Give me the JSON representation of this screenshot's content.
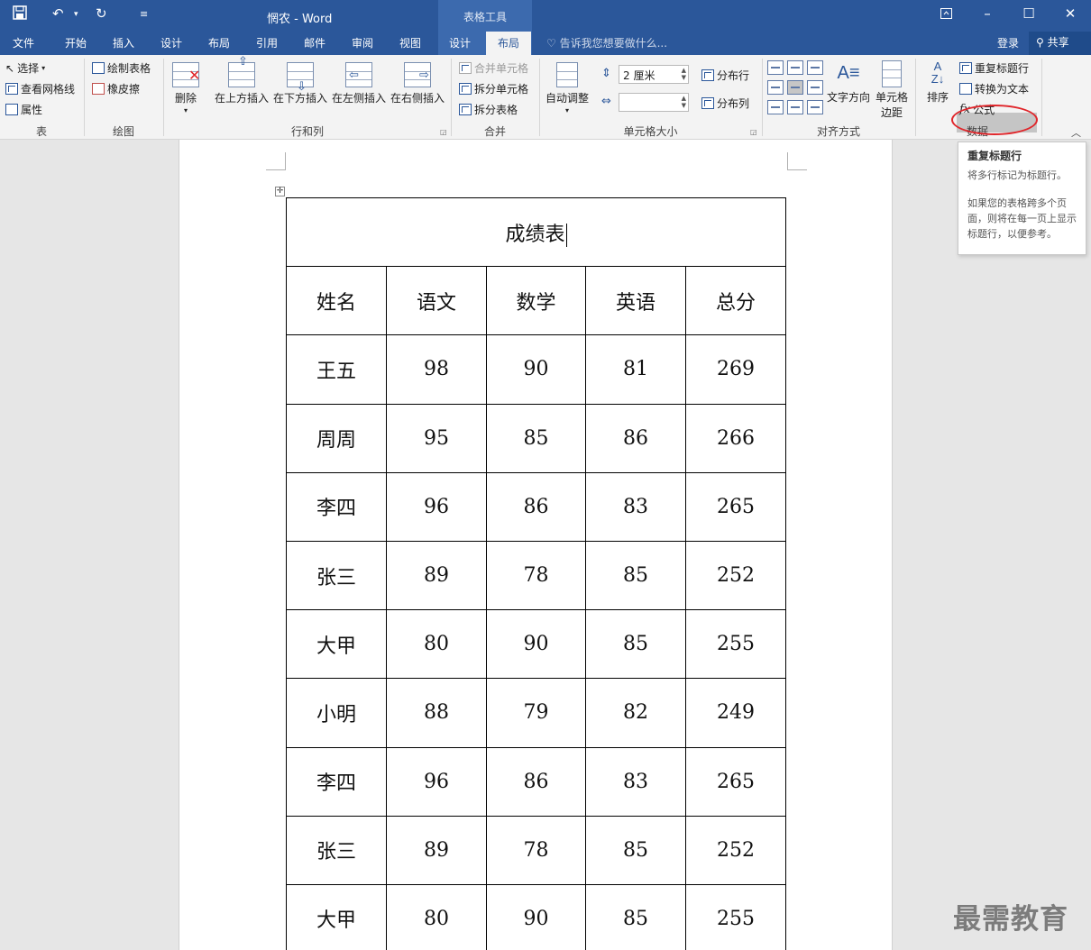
{
  "app": {
    "doc_title": "惘农 - Word",
    "context_label": "表格工具"
  },
  "tabs": [
    "文件",
    "开始",
    "插入",
    "设计",
    "布局",
    "引用",
    "邮件",
    "审阅",
    "视图",
    "设计"
  ],
  "active_tab": "布局",
  "tell_me": "告诉我您想要做什么...",
  "login": "登录",
  "share": "共享",
  "ribbon": {
    "table": {
      "select": "选择",
      "view_gridlines": "查看网格线",
      "properties": "属性",
      "label": "表"
    },
    "draw": {
      "draw_table": "绘制表格",
      "eraser": "橡皮擦",
      "label": "绘图"
    },
    "rows_cols": {
      "delete": "删除",
      "insert_above": "在上方插入",
      "insert_below": "在下方插入",
      "insert_left": "在左侧插入",
      "insert_right": "在右侧插入",
      "label": "行和列"
    },
    "merge": {
      "merge_cells": "合并单元格",
      "split_cells": "拆分单元格",
      "split_table": "拆分表格",
      "label": "合并"
    },
    "cell_size": {
      "autofit": "自动调整",
      "height_value": "2 厘米",
      "width_value": "",
      "distribute_rows": "分布行",
      "distribute_cols": "分布列",
      "label": "单元格大小"
    },
    "alignment": {
      "text_direction": "文字方向",
      "cell_margins_1": "单元格",
      "cell_margins_2": "边距",
      "label": "对齐方式"
    },
    "data": {
      "sort": "排序",
      "repeat_header": "重复标题行",
      "convert_to_text": "转换为文本",
      "formula": "公式",
      "label": "数据"
    }
  },
  "tooltip": {
    "title": "重复标题行",
    "line1": "将多行标记为标题行。",
    "line2": "如果您的表格跨多个页面，则将在每一页上显示标题行，以便参考。"
  },
  "table": {
    "title": "成绩表",
    "headers": [
      "姓名",
      "语文",
      "数学",
      "英语",
      "总分"
    ],
    "rows": [
      [
        "王五",
        "98",
        "90",
        "81",
        "269"
      ],
      [
        "周周",
        "95",
        "85",
        "86",
        "266"
      ],
      [
        "李四",
        "96",
        "86",
        "83",
        "265"
      ],
      [
        "张三",
        "89",
        "78",
        "85",
        "252"
      ],
      [
        "大甲",
        "80",
        "90",
        "85",
        "255"
      ],
      [
        "小明",
        "88",
        "79",
        "82",
        "249"
      ],
      [
        "李四",
        "96",
        "86",
        "83",
        "265"
      ],
      [
        "张三",
        "89",
        "78",
        "85",
        "252"
      ],
      [
        "大甲",
        "80",
        "90",
        "85",
        "255"
      ]
    ]
  },
  "watermark": "最需教育",
  "colors": {
    "brand": "#2b579a",
    "highlight_ellipse": "#e0262b"
  },
  "icons": [
    "save-icon",
    "undo-icon",
    "redo-icon",
    "customize-icon",
    "ribbon-options-icon",
    "minimize-icon",
    "maximize-icon",
    "close-icon",
    "lightbulb-icon",
    "person-icon",
    "collapse-ribbon-icon",
    "table-move-handle-icon"
  ]
}
